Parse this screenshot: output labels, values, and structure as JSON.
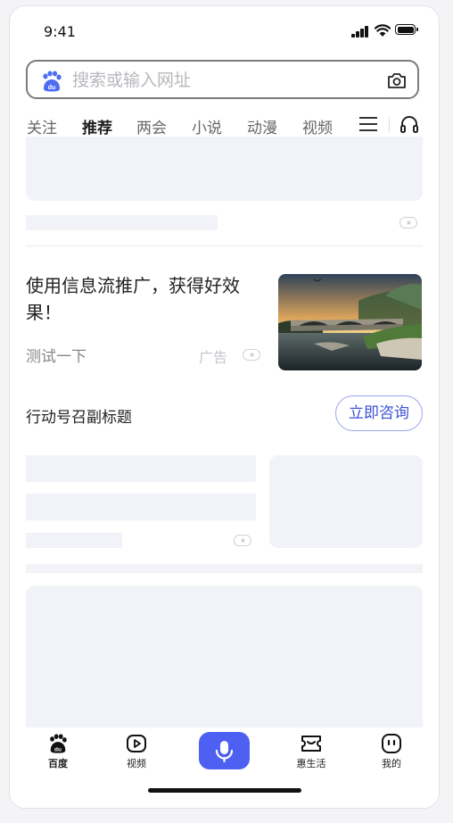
{
  "status_bar": {
    "time": "9:41"
  },
  "search": {
    "placeholder": "搜索或输入网址",
    "value": ""
  },
  "tabs": [
    {
      "label": "关注",
      "active": false
    },
    {
      "label": "推荐",
      "active": true
    },
    {
      "label": "两会",
      "active": false
    },
    {
      "label": "小说",
      "active": false
    },
    {
      "label": "动漫",
      "active": false
    },
    {
      "label": "视频",
      "active": false
    }
  ],
  "ad": {
    "title": "使用信息流推广，获得好效果！",
    "subtitle": "测试一下",
    "tag": "广告"
  },
  "cta": {
    "title": "行动号召副标题",
    "button": "立即咨询"
  },
  "bottom_nav": [
    {
      "label": "百度",
      "icon": "baidu-paw-icon",
      "active": true
    },
    {
      "label": "视频",
      "icon": "video-play-icon",
      "active": false
    },
    {
      "label": "",
      "icon": "microphone-icon",
      "active": false
    },
    {
      "label": "惠生活",
      "icon": "coupon-icon",
      "active": false
    },
    {
      "label": "我的",
      "icon": "profile-face-icon",
      "active": false
    }
  ],
  "colors": {
    "accent": "#4e60f1",
    "cta_text": "#3a50d8",
    "placeholder_bg": "#f2f3f8"
  }
}
